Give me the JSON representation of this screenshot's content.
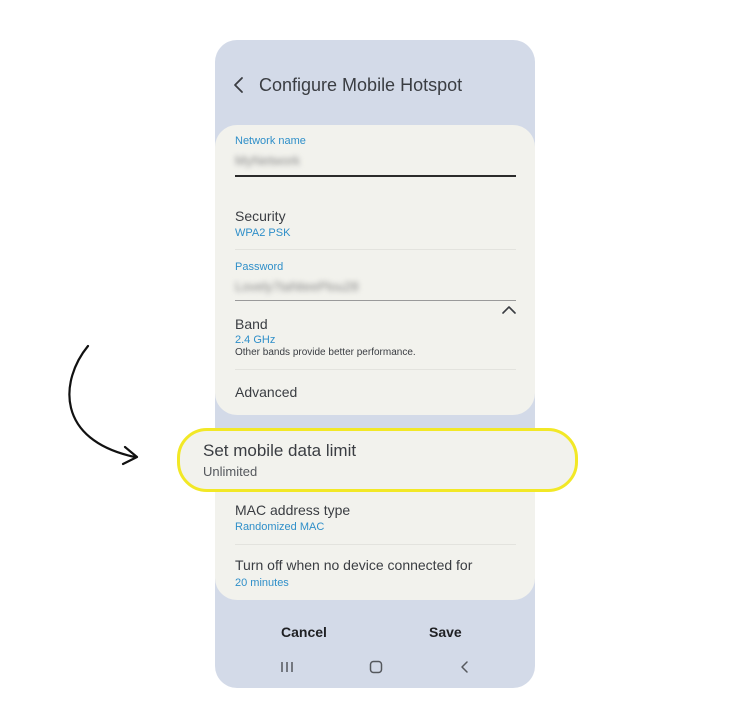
{
  "header": {
    "title": "Configure Mobile Hotspot",
    "back_icon": "chevron-left-icon"
  },
  "network": {
    "label": "Network name",
    "value": "MyNetwork"
  },
  "security": {
    "title": "Security",
    "value": "WPA2 PSK"
  },
  "password": {
    "label": "Password",
    "value": "Lovely7taNteePlou28"
  },
  "band": {
    "title": "Band",
    "value": "2.4 GHz",
    "note": "Other bands provide better performance."
  },
  "advanced": {
    "title": "Advanced",
    "icon": "chevron-up-icon"
  },
  "data_limit": {
    "title": "Set mobile data limit",
    "value": "Unlimited"
  },
  "mac": {
    "title": "MAC address type",
    "value": "Randomized MAC"
  },
  "timeout": {
    "title": "Turn off when no device connected for",
    "value": "20 minutes"
  },
  "footer": {
    "cancel_label": "Cancel",
    "save_label": "Save"
  },
  "nav": {
    "recents_icon": "recents-icon",
    "home_icon": "home-icon",
    "back_icon": "back-icon"
  },
  "colors": {
    "accent": "#2f8fc9",
    "highlight_border": "#f2e826",
    "phone_bg": "#d3dae8",
    "card_bg": "#f2f2ed"
  }
}
